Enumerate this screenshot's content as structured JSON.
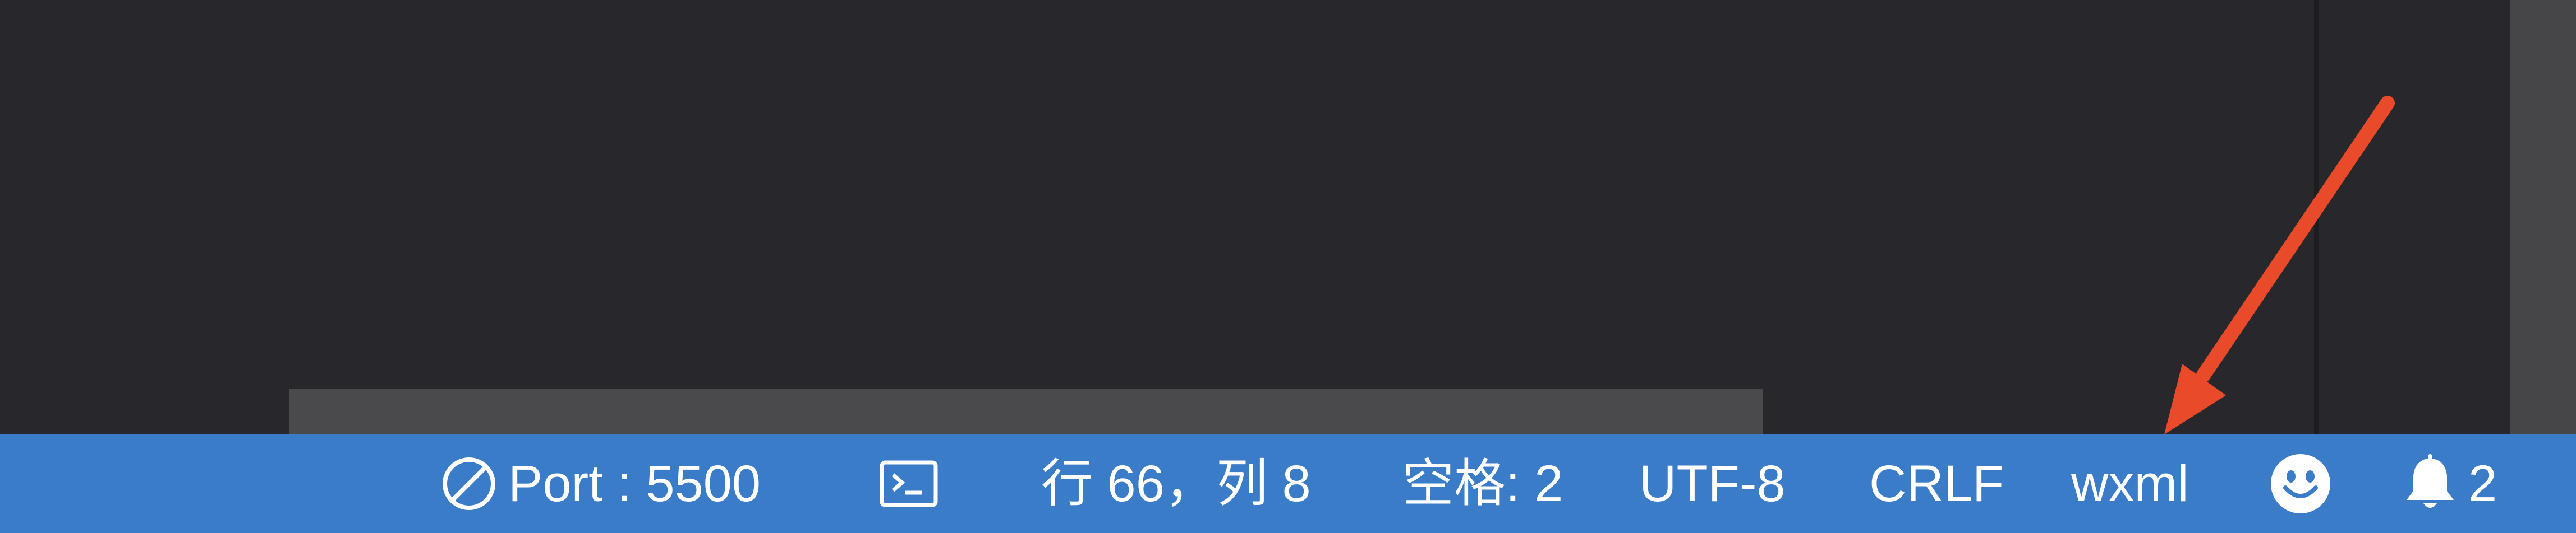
{
  "status_bar": {
    "port": {
      "icon": "no-entry-icon",
      "label": "Port : 5500"
    },
    "terminal": {
      "icon": "terminal-icon"
    },
    "cursor_position": "行 66，列 8",
    "indentation": "空格: 2",
    "encoding": "UTF-8",
    "line_ending": "CRLF",
    "language_mode": "wxml",
    "feedback": {
      "icon": "smiley-icon"
    },
    "notifications": {
      "icon": "bell-icon",
      "count": "2"
    }
  },
  "colors": {
    "editor_background": "#28272c",
    "status_bar_background": "#3b7cc8",
    "status_bar_foreground": "#ffffff",
    "annotation_arrow": "#e94b2a"
  }
}
